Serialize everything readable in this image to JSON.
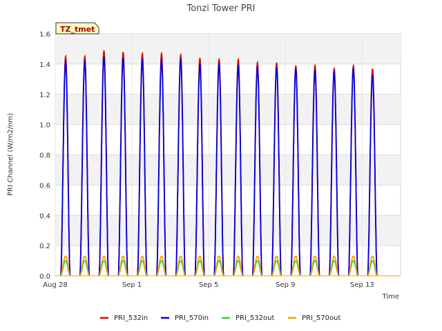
{
  "chart_data": {
    "type": "line",
    "title": "Tonzi Tower PRI",
    "xlabel": "Time",
    "ylabel": "PRI Channel (W/m2/nm)",
    "ylim": [
      0,
      1.6
    ],
    "xlim": [
      "2023-08-28",
      "2023-09-15"
    ],
    "y_ticks": [
      "0.0",
      "0.2",
      "0.4",
      "0.6",
      "0.8",
      "1.0",
      "1.2",
      "1.4",
      "1.6"
    ],
    "x_ticks": [
      {
        "date": "2023-08-28",
        "label": "Aug 28"
      },
      {
        "date": "2023-09-01",
        "label": "Sep 1"
      },
      {
        "date": "2023-09-05",
        "label": "Sep 5"
      },
      {
        "date": "2023-09-09",
        "label": "Sep 9"
      },
      {
        "date": "2023-09-13",
        "label": "Sep 13"
      }
    ],
    "annotation": "TZ_tmet",
    "grid": true,
    "banded_background": true,
    "legend_position": "bottom",
    "days": [
      "2023-08-28",
      "2023-08-29",
      "2023-08-30",
      "2023-08-31",
      "2023-09-01",
      "2023-09-02",
      "2023-09-03",
      "2023-09-04",
      "2023-09-05",
      "2023-09-06",
      "2023-09-07",
      "2023-09-08",
      "2023-09-09",
      "2023-09-10",
      "2023-09-11",
      "2023-09-12",
      "2023-09-13",
      "2023-09-14"
    ],
    "series": [
      {
        "name": "PRI_532in",
        "color": "#e00000",
        "daily_peak": [
          1.45,
          1.45,
          1.49,
          1.48,
          1.47,
          1.47,
          1.46,
          1.44,
          1.43,
          1.43,
          1.41,
          1.41,
          1.39,
          1.39,
          1.37,
          1.39,
          1.37
        ]
      },
      {
        "name": "PRI_570in",
        "color": "#0000dd",
        "daily_peak": [
          1.42,
          1.42,
          1.45,
          1.44,
          1.43,
          1.43,
          1.43,
          1.4,
          1.4,
          1.39,
          1.38,
          1.38,
          1.37,
          1.36,
          1.35,
          1.37,
          1.33
        ]
      },
      {
        "name": "PRI_532out",
        "color": "#22dd22",
        "daily_peak": [
          0.1,
          0.1,
          0.1,
          0.1,
          0.1,
          0.1,
          0.1,
          0.1,
          0.1,
          0.1,
          0.1,
          0.1,
          0.1,
          0.1,
          0.1,
          0.1,
          0.1
        ]
      },
      {
        "name": "PRI_570out",
        "color": "#f0a000",
        "daily_peak": [
          0.13,
          0.13,
          0.13,
          0.13,
          0.13,
          0.13,
          0.13,
          0.13,
          0.13,
          0.13,
          0.13,
          0.13,
          0.13,
          0.13,
          0.13,
          0.13,
          0.13
        ]
      }
    ]
  }
}
